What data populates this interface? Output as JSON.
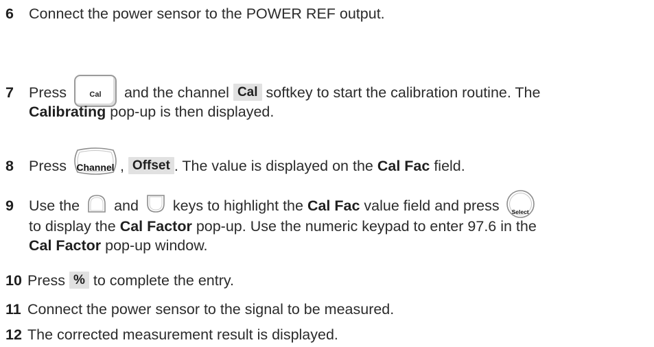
{
  "steps": [
    {
      "num": "6",
      "text": "Connect the power sensor to the POWER REF output."
    },
    {
      "num": "7",
      "a": "Press",
      "key": "Cal",
      "b": "and the channel",
      "softkey": "Cal",
      "c": "softkey to start the calibration routine. The",
      "bold1": "Calibrating",
      "d": "pop-up is then displayed."
    },
    {
      "num": "8",
      "a": "Press",
      "key": "Channel",
      "comma": ",",
      "softkey": "Offset",
      "b": ". The value is displayed on the",
      "bold1": "Cal Fac",
      "c": "field."
    },
    {
      "num": "9",
      "a": "Use the",
      "b": "and",
      "c": "keys to highlight the",
      "bold1": "Cal Fac",
      "d": "value field and press",
      "key": "Select",
      "e": "to display the",
      "bold2": "Cal Factor",
      "f": "pop-up. Use the numeric keypad to enter 97.6 in the",
      "bold3": "Cal Factor",
      "g": "pop-up window."
    },
    {
      "num": "10",
      "a": "Press",
      "softkey": "%",
      "b": "to complete the entry."
    },
    {
      "num": "11",
      "text": "Connect the power sensor to the signal to be measured."
    },
    {
      "num": "12",
      "text": "The corrected measurement result is displayed."
    }
  ],
  "icons": [
    "cal-key-icon",
    "channel-key-icon",
    "up-arrow-key-icon",
    "down-arrow-key-icon",
    "select-key-icon"
  ]
}
